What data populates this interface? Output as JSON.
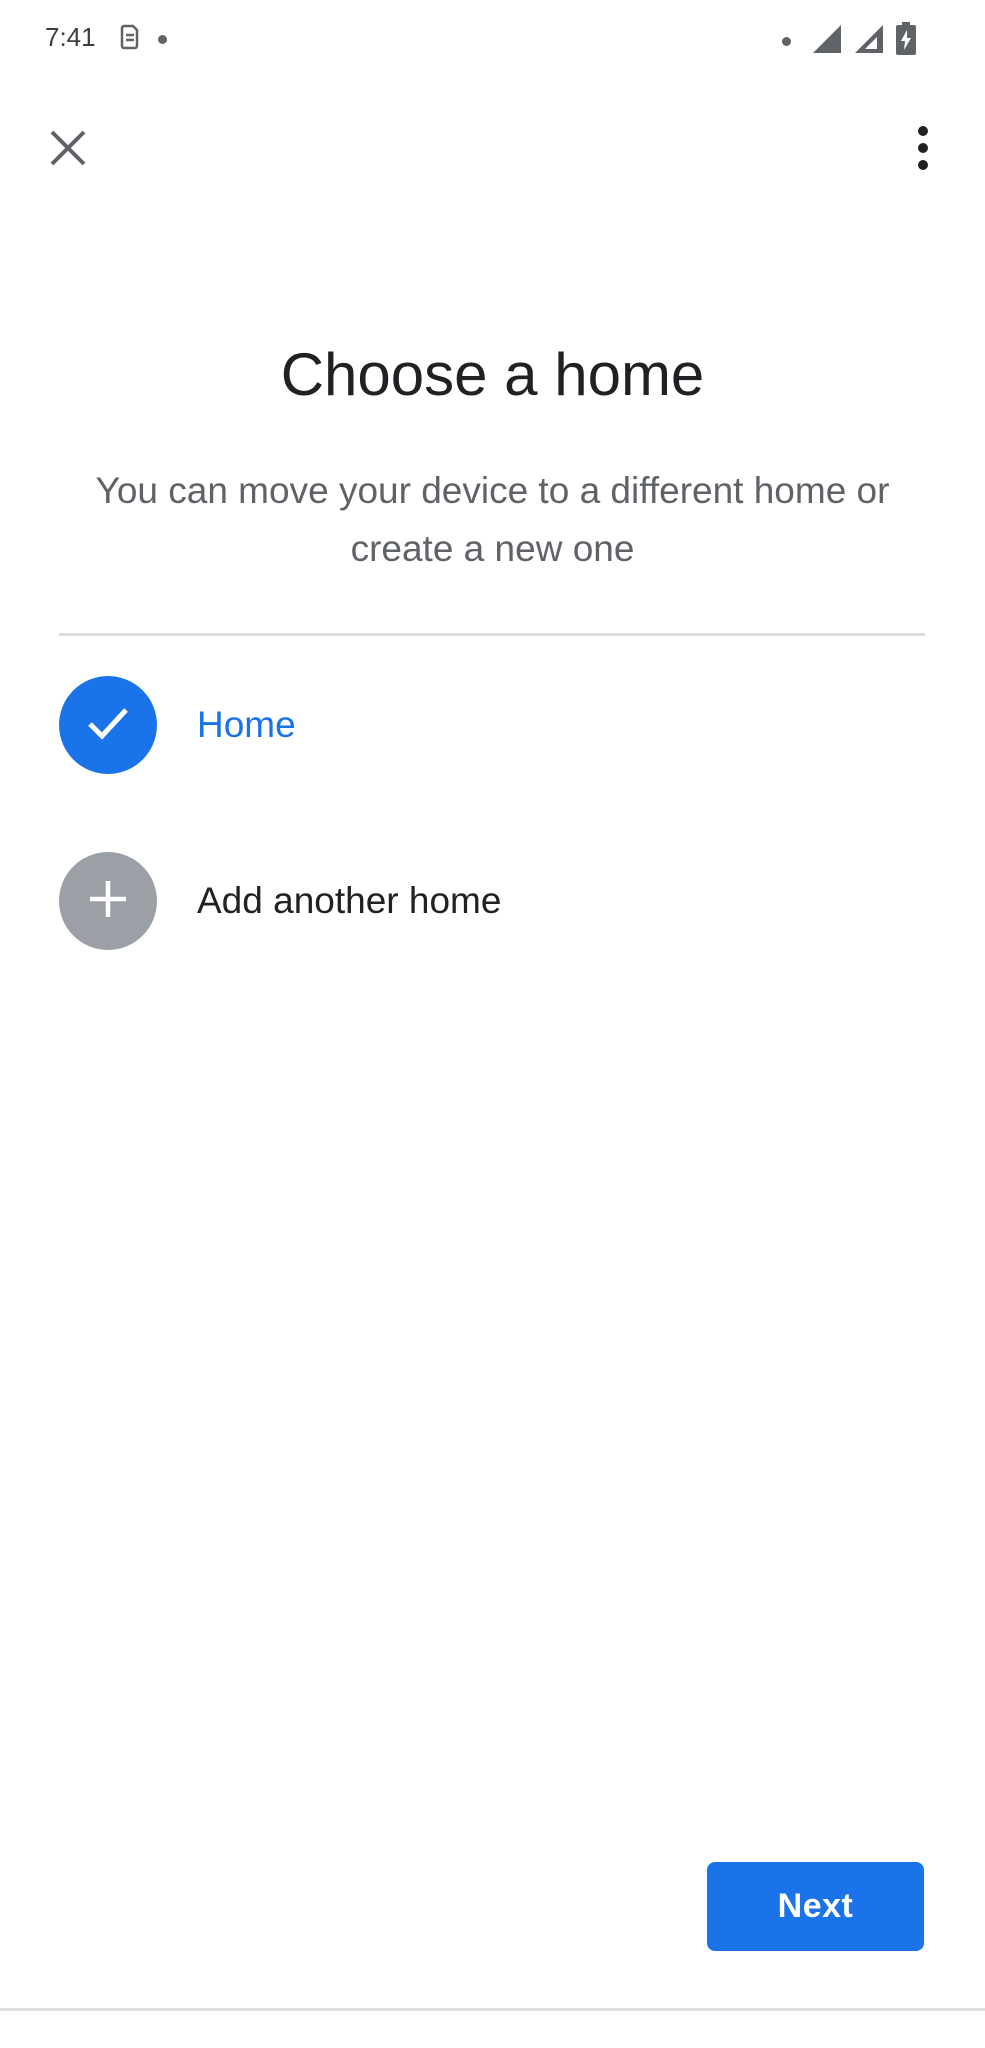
{
  "status_bar": {
    "time": "7:41",
    "left_icons": [
      "sim-card-icon",
      "notification-dot-icon"
    ],
    "right_icons": [
      "notification-dot-icon",
      "signal-icon",
      "signal-icon",
      "battery-charging-icon"
    ]
  },
  "top_bar": {
    "close_icon": "close-icon",
    "more_icon": "more-vert-icon"
  },
  "main": {
    "title": "Choose a home",
    "subtitle": "You can move your device to a different home or create a new one",
    "options": [
      {
        "label": "Home",
        "icon": "check-icon",
        "selected": true
      },
      {
        "label": "Add another home",
        "icon": "plus-icon",
        "selected": false
      }
    ]
  },
  "footer": {
    "next_label": "Next"
  },
  "colors": {
    "accent": "#1a73e8",
    "muted_circle": "#9aa0a6",
    "subtitle": "#5f6368",
    "divider": "#dadce0"
  }
}
